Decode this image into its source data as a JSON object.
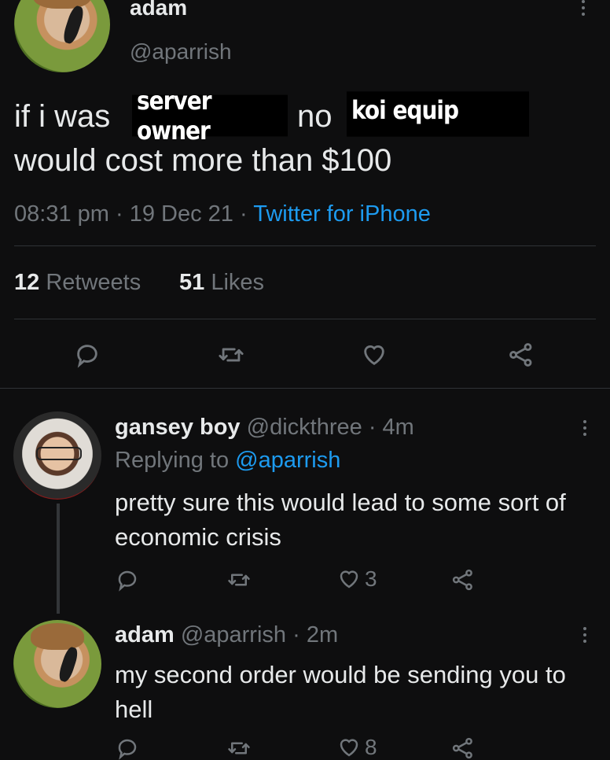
{
  "main_tweet": {
    "author_name": "adam",
    "author_handle": "@aparrish",
    "text_part1": "if i was",
    "redacted_1": "server owner",
    "text_part2": "no",
    "redacted_2": "koi equip",
    "text_line2": "would cost more than $100",
    "time": "08:31 pm",
    "date": "19 Dec 21",
    "sep": "·",
    "source": "Twitter for iPhone",
    "retweets_count": "12",
    "retweets_label": "Retweets",
    "likes_count": "51",
    "likes_label": "Likes"
  },
  "replies": [
    {
      "author_name": "gansey boy",
      "author_handle": "@dickthree",
      "age": "· 4m",
      "replying_label": "Replying to",
      "replying_handle": "@aparrish",
      "text": "pretty sure this would lead to some sort of economic crisis",
      "like_count": "3"
    },
    {
      "author_name": "adam",
      "author_handle": "@aparrish",
      "age": "· 2m",
      "text": "my second order would be sending you to hell",
      "like_count": "8"
    }
  ],
  "icons": [
    "more-icon",
    "reply-icon",
    "retweet-icon",
    "like-icon",
    "share-icon"
  ],
  "colors": {
    "background": "#0e0e0f",
    "text": "#e7e9ea",
    "muted": "#71767b",
    "link": "#1d9bf0"
  }
}
